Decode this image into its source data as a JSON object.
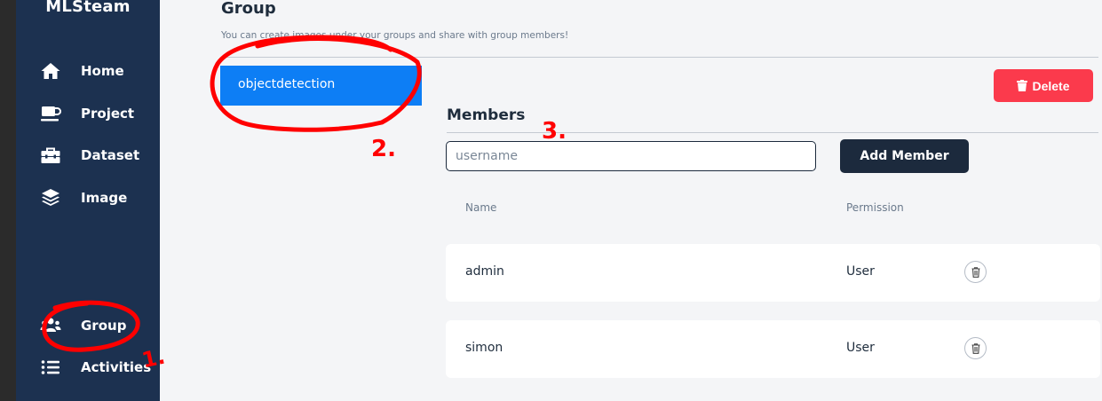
{
  "app": {
    "brand": "MLSteam"
  },
  "sidebar": {
    "items": [
      {
        "label": "Home",
        "icon": "home-icon"
      },
      {
        "label": "Project",
        "icon": "mug-icon"
      },
      {
        "label": "Dataset",
        "icon": "toolbox-icon"
      },
      {
        "label": "Image",
        "icon": "layers-icon"
      },
      {
        "label": "Group",
        "icon": "users-icon"
      },
      {
        "label": "Activities",
        "icon": "list-icon"
      }
    ]
  },
  "page": {
    "title": "Group",
    "subtitle": "You can create images under your groups and share with group members!"
  },
  "groups": {
    "selected": "objectdetection"
  },
  "actions": {
    "delete_label": "Delete"
  },
  "members": {
    "title": "Members",
    "input_placeholder": "username",
    "input_value": "",
    "add_label": "Add Member",
    "columns": {
      "name": "Name",
      "permission": "Permission"
    },
    "rows": [
      {
        "name": "admin",
        "permission": "User"
      },
      {
        "name": "simon",
        "permission": "User"
      }
    ]
  },
  "annotations": {
    "color": "#ff0000",
    "labels": [
      "1.",
      "2.",
      "3."
    ]
  }
}
